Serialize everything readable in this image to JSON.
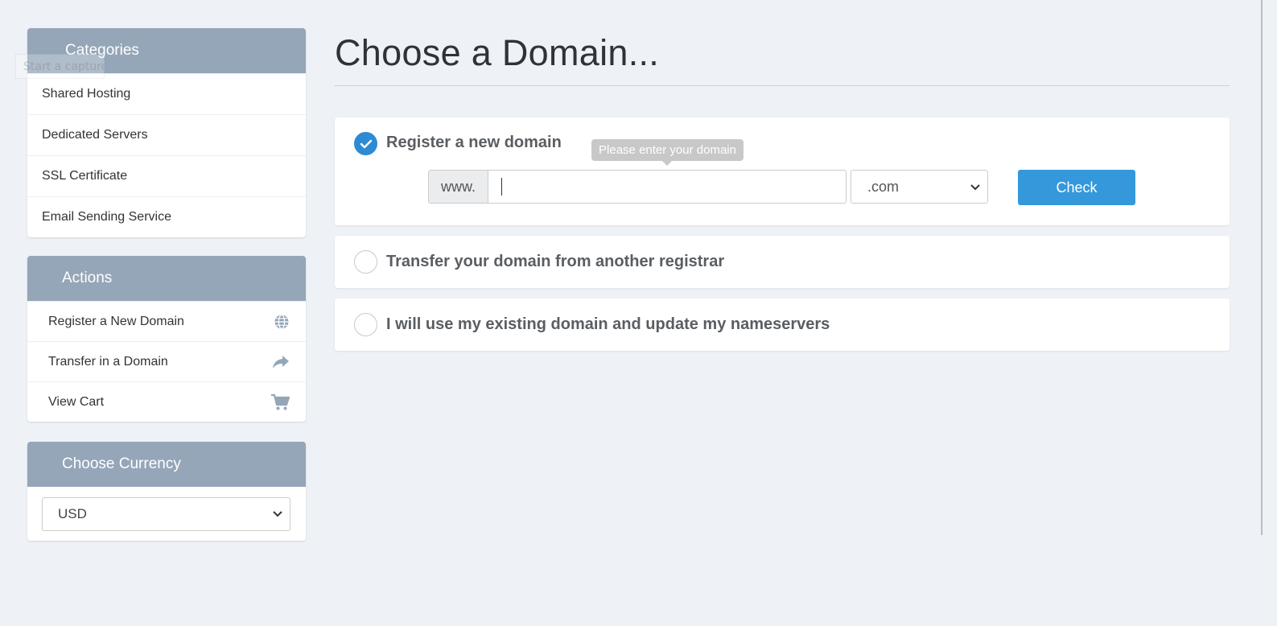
{
  "overlay": {
    "capture_text": "Start a capture"
  },
  "sidebar": {
    "categories": {
      "title": "Categories",
      "items": [
        {
          "label": "Shared Hosting"
        },
        {
          "label": "Dedicated Servers"
        },
        {
          "label": "SSL Certificate"
        },
        {
          "label": "Email Sending Service"
        }
      ]
    },
    "actions": {
      "title": "Actions",
      "items": [
        {
          "label": "Register a New Domain",
          "icon": "globe-icon"
        },
        {
          "label": "Transfer in a Domain",
          "icon": "share-arrow-icon"
        },
        {
          "label": "View Cart",
          "icon": "cart-icon"
        }
      ]
    },
    "currency": {
      "title": "Choose Currency",
      "selected": "USD"
    }
  },
  "main": {
    "title": "Choose a Domain...",
    "options": {
      "register": {
        "label": "Register a new domain",
        "checked": true,
        "prefix": "www.",
        "input_value": "",
        "tooltip": "Please enter your domain",
        "tld_selected": ".com",
        "check_label": "Check"
      },
      "transfer": {
        "label": "Transfer your domain from another registrar",
        "checked": false
      },
      "existing": {
        "label": "I will use my existing domain and update my nameservers",
        "checked": false
      }
    }
  },
  "colors": {
    "panel_header": "#94a6b8",
    "accent": "#3498db",
    "radio_checked": "#2d8bd3",
    "background": "#eef2f6"
  }
}
